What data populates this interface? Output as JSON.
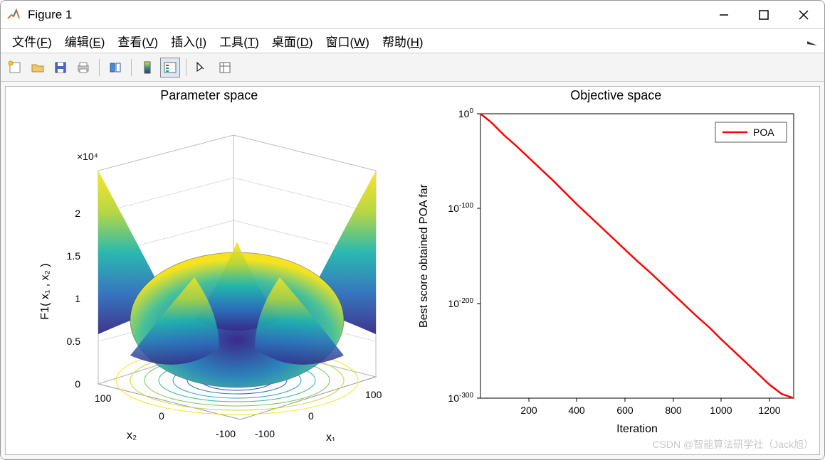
{
  "window": {
    "title": "Figure 1"
  },
  "menubar": {
    "items": [
      {
        "label": "文件",
        "key": "F"
      },
      {
        "label": "编辑",
        "key": "E"
      },
      {
        "label": "查看",
        "key": "V"
      },
      {
        "label": "插入",
        "key": "I"
      },
      {
        "label": "工具",
        "key": "T"
      },
      {
        "label": "桌面",
        "key": "D"
      },
      {
        "label": "窗口",
        "key": "W"
      },
      {
        "label": "帮助",
        "key": "H"
      }
    ]
  },
  "toolbar": {
    "buttons": [
      "new-figure",
      "open-file",
      "save",
      "print",
      "sep",
      "link-brush",
      "sep",
      "insert-colorbar",
      "insert-legend",
      "sep",
      "edit-plot",
      "open-property-inspector"
    ]
  },
  "watermark": "CSDN @智能算法研学社（Jack旭）",
  "chart_data": [
    {
      "type": "surface3d",
      "title": "Parameter space",
      "xlabel": "x₁",
      "ylabel": "x₂",
      "zlabel": "F1( x₁ , x₂ )",
      "x_range": [
        -100,
        100
      ],
      "y_range": [
        -100,
        100
      ],
      "z_range": [
        0,
        20000.0
      ],
      "x_ticks": [
        -100,
        0,
        100
      ],
      "y_ticks": [
        -100,
        0,
        100
      ],
      "z_ticks": [
        0,
        0.5,
        1,
        1.5,
        2
      ],
      "z_multiplier": "×10⁴",
      "description": "3D surface of F1(x1,x2) = x1^2 + x2^2 style bowl with four peaked corners, contour projection on floor",
      "colormap": "parula"
    },
    {
      "type": "semilogy",
      "title": "Objective space",
      "xlabel": "Iteration",
      "ylabel": "Best score obtained POA far",
      "xlim": [
        0,
        1300
      ],
      "ylim": [
        1e-300,
        1.0
      ],
      "x_ticks": [
        200,
        400,
        600,
        800,
        1000,
        1200
      ],
      "y_ticks": [
        "10⁰",
        "10⁻¹⁰⁰",
        "10⁻²⁰⁰",
        "10⁻³⁰⁰"
      ],
      "y_tick_values": [
        1,
        1e-100,
        1e-200,
        1e-300
      ],
      "series": [
        {
          "name": "POA",
          "color": "#ff0000",
          "x": [
            0,
            100,
            200,
            300,
            400,
            500,
            600,
            700,
            800,
            900,
            1000,
            1100,
            1200,
            1300
          ],
          "y": [
            1,
            1e-23,
            1e-46,
            1e-69,
            1e-92,
            1e-115,
            1e-138,
            1e-161,
            1e-184,
            1e-207,
            1e-230,
            1e-253,
            1e-276,
            1e-300
          ]
        }
      ],
      "legend": {
        "position": "northeast",
        "entries": [
          "POA"
        ]
      }
    }
  ]
}
